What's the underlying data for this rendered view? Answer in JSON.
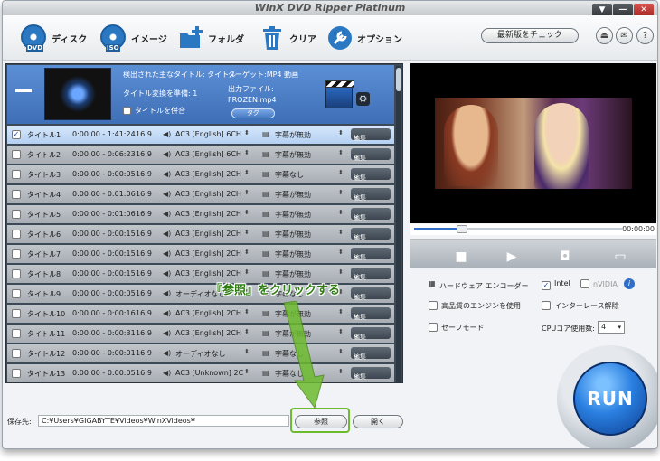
{
  "app": {
    "title": "WinX DVD Ripper Platinum"
  },
  "window_controls": [
    "▼",
    "—",
    "✕"
  ],
  "toolbar": {
    "disc": {
      "label": "ディスク",
      "badge": "DVD"
    },
    "image": {
      "label": "イメージ",
      "badge": "ISO"
    },
    "folder": {
      "label": "フォルダ"
    },
    "clear": {
      "label": "クリア"
    },
    "option": {
      "label": "オプション"
    },
    "update": "最新版をチェック"
  },
  "header": {
    "main_title_label": "検出された主なタイトル: タイトル",
    "ready_label": "タイトル変換を準備: 1",
    "merge_label": "タイトルを併合",
    "target_label": "ターゲット:MP4 動画",
    "output_label": "出力ファイル:",
    "output_file": "FROZEN.mp4",
    "tag_button": "タグ"
  },
  "rows": [
    {
      "title": "タイトル1",
      "time": "0:00:00 - 1:41:24",
      "ratio": "16:9",
      "audio": "AC3 [English] 6CH",
      "subs": "字幕が無効",
      "edit": "編集",
      "checked": true,
      "selected": true
    },
    {
      "title": "タイトル2",
      "time": "0:00:00 - 0:06:23",
      "ratio": "16:9",
      "audio": "AC3 [English] 6CH",
      "subs": "字幕が無効",
      "edit": "編集",
      "checked": false
    },
    {
      "title": "タイトル3",
      "time": "0:00:00 - 0:00:05",
      "ratio": "16:9",
      "audio": "AC3 [English] 2CH",
      "subs": "字幕なし",
      "edit": "編集",
      "checked": false
    },
    {
      "title": "タイトル4",
      "time": "0:00:00 - 0:01:06",
      "ratio": "16:9",
      "audio": "AC3 [English] 2CH",
      "subs": "字幕が無効",
      "edit": "編集",
      "checked": false
    },
    {
      "title": "タイトル5",
      "time": "0:00:00 - 0:01:06",
      "ratio": "16:9",
      "audio": "AC3 [English] 2CH",
      "subs": "字幕が無効",
      "edit": "編集",
      "checked": false
    },
    {
      "title": "タイトル6",
      "time": "0:00:00 - 0:00:15",
      "ratio": "16:9",
      "audio": "AC3 [English] 2CH",
      "subs": "字幕が無効",
      "edit": "編集",
      "checked": false
    },
    {
      "title": "タイトル7",
      "time": "0:00:00 - 0:00:15",
      "ratio": "16:9",
      "audio": "AC3 [English] 2CH",
      "subs": "字幕が無効",
      "edit": "編集",
      "checked": false
    },
    {
      "title": "タイトル8",
      "time": "0:00:00 - 0:00:15",
      "ratio": "16:9",
      "audio": "AC3 [English] 2CH",
      "subs": "字幕が無効",
      "edit": "編集",
      "checked": false
    },
    {
      "title": "タイトル9",
      "time": "0:00:00 - 0:00:05",
      "ratio": "16:9",
      "audio": "オーディオなし",
      "subs": "字幕なし",
      "edit": "編集",
      "checked": false
    },
    {
      "title": "タイトル10",
      "time": "0:00:00 - 0:00:16",
      "ratio": "16:9",
      "audio": "AC3 [English] 2CH",
      "subs": "字幕が無効",
      "edit": "編集",
      "checked": false
    },
    {
      "title": "タイトル11",
      "time": "0:00:00 - 0:00:31",
      "ratio": "16:9",
      "audio": "AC3 [English] 2CH",
      "subs": "字幕が無効",
      "edit": "編集",
      "checked": false
    },
    {
      "title": "タイトル12",
      "time": "0:00:00 - 0:00:01",
      "ratio": "16:9",
      "audio": "オーディオなし",
      "subs": "字幕なし",
      "edit": "編集",
      "checked": false
    },
    {
      "title": "タイトル13",
      "time": "0:00:00 - 0:00:05",
      "ratio": "16:9",
      "audio": "AC3 [Unknown] 2C",
      "subs": "字幕なし",
      "edit": "編集",
      "checked": false
    }
  ],
  "callout": "『参照』をクリックする",
  "save": {
    "label": "保存先:",
    "path": "C:¥Users¥GIGABYTE¥Videos¥WinXVideos¥",
    "browse": "参照",
    "open": "開く"
  },
  "player": {
    "time": "00:00:00",
    "progress": 0.22
  },
  "options": {
    "hw_encoder": "ハードウェア エンコーダー",
    "intel": "Intel",
    "nvidia": "nVIDIA",
    "hq_engine": "高品質のエンジンを使用",
    "deinterlace": "インターレース解除",
    "safe_mode": "セーフモード",
    "cpu_label": "CPUコア使用数:",
    "cpu_value": "4"
  },
  "run": "RUN",
  "colors": {
    "accent": "#2f6fc8",
    "highlight": "#6dbb2f",
    "callout": "#2e7d12"
  }
}
